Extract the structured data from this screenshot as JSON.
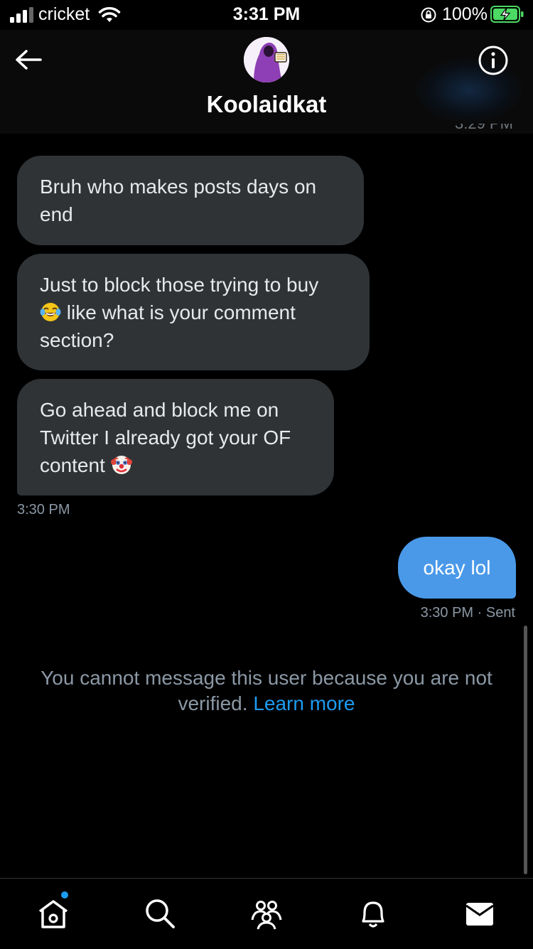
{
  "status_bar": {
    "carrier": "cricket",
    "time": "3:31 PM",
    "battery": "100%"
  },
  "header": {
    "name": "Koolaidkat"
  },
  "conversation": {
    "partial_timestamp": "3:29 PM",
    "received": [
      {
        "text": "Bruh who makes posts days on end"
      },
      {
        "text_a": "Just to block those trying to buy",
        "emoji": "face-with-tears-of-joy",
        "text_b": " like what is your comment section?"
      },
      {
        "text": "Go ahead and block me on Twitter I already got your OF content ",
        "emoji": "clown-face"
      }
    ],
    "received_time": "3:30 PM",
    "sent": {
      "text": "okay lol",
      "time": "3:30 PM · Sent"
    }
  },
  "notice": {
    "text": "You cannot message this user because you are not verified. ",
    "link": "Learn more"
  },
  "colors": {
    "background": "#000000",
    "bubble_received": "#2f3336",
    "bubble_sent": "#4a99e9",
    "link": "#1d9bf0",
    "muted": "#8b98a5"
  },
  "tabs": [
    "home-icon",
    "search-icon",
    "communities-icon",
    "notifications-icon",
    "messages-icon"
  ]
}
